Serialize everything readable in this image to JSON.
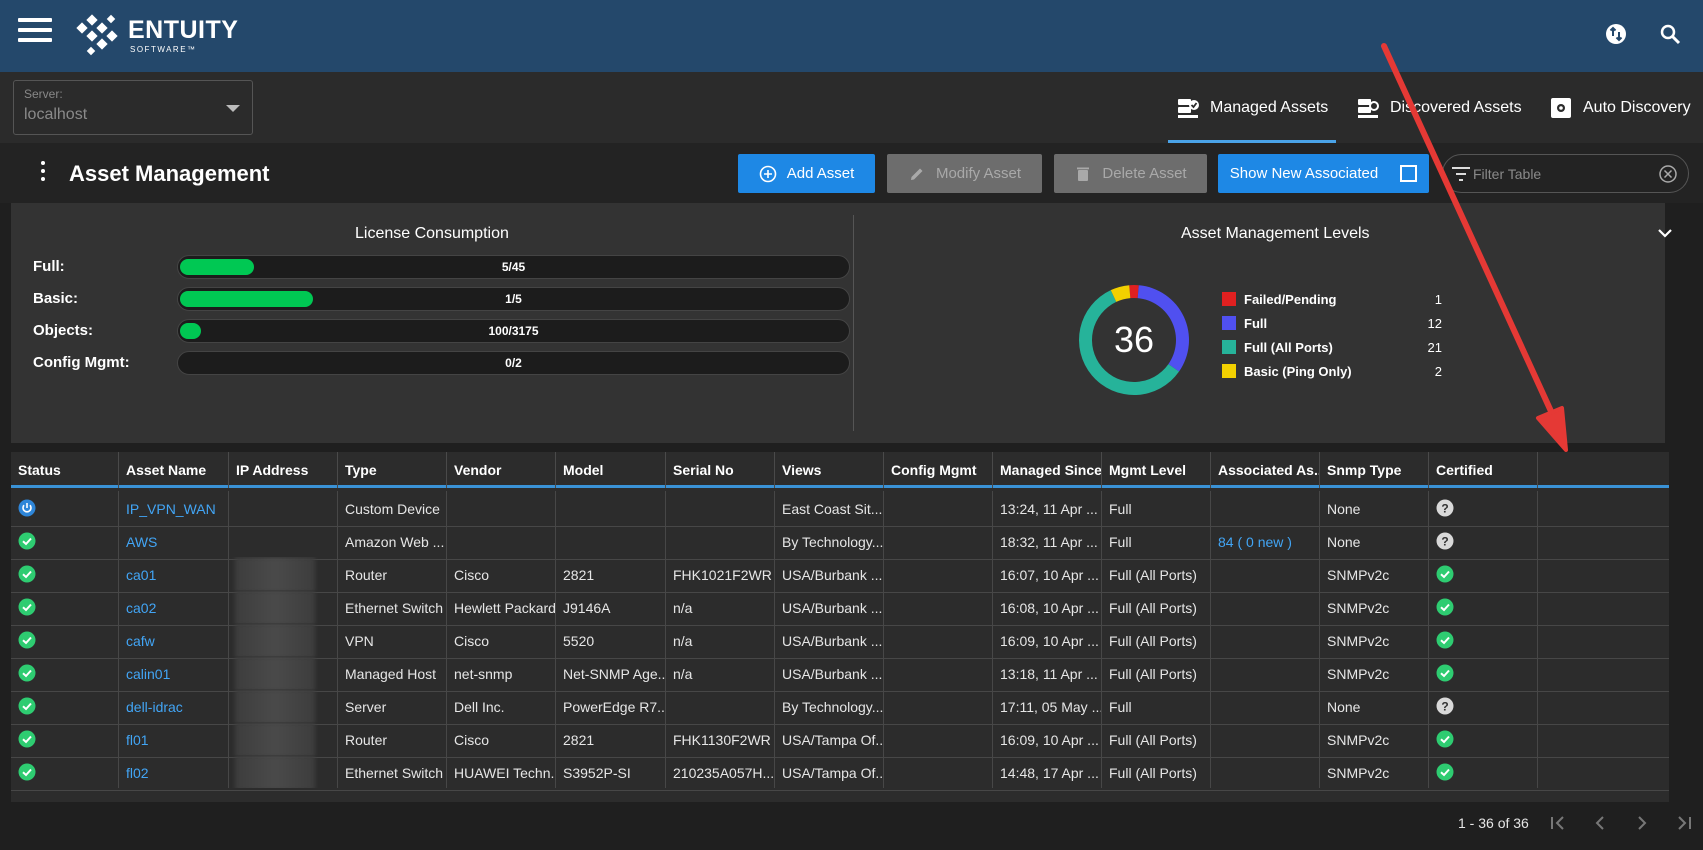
{
  "brand": {
    "name": "ENTUITY",
    "tagline": "SOFTWARE™"
  },
  "server": {
    "label": "Server:",
    "value": "localhost"
  },
  "nav_tabs": [
    {
      "label": "Managed Assets",
      "active": true
    },
    {
      "label": "Discovered Assets",
      "active": false
    },
    {
      "label": "Auto Discovery",
      "active": false
    }
  ],
  "page": {
    "title": "Asset Management"
  },
  "toolbar": {
    "add_label": "Add Asset",
    "modify_label": "Modify Asset",
    "delete_label": "Delete Asset",
    "show_new_label": "Show New Associated",
    "filter_placeholder": "Filter Table"
  },
  "license": {
    "title": "License Consumption",
    "rows": [
      {
        "label": "Full:",
        "value": "5/45",
        "fraction": 0.111
      },
      {
        "label": "Basic:",
        "value": "1/5",
        "fraction": 0.2
      },
      {
        "label": "Objects:",
        "value": "100/3175",
        "fraction": 0.031
      },
      {
        "label": "Config Mgmt:",
        "value": "0/2",
        "fraction": 0
      }
    ]
  },
  "levels": {
    "title": "Asset Management Levels",
    "total": "36",
    "items": [
      {
        "name": "Failed/Pending",
        "count": 1,
        "color": "#e02020"
      },
      {
        "name": "Full",
        "count": 12,
        "color": "#5050f0"
      },
      {
        "name": "Full (All Ports)",
        "count": 21,
        "color": "#26b39a"
      },
      {
        "name": "Basic (Ping Only)",
        "count": 2,
        "color": "#f2d000"
      }
    ]
  },
  "table": {
    "columns": [
      "Status",
      "Asset Name",
      "IP Address",
      "Type",
      "Vendor",
      "Model",
      "Serial No",
      "Views",
      "Config Mgmt",
      "Managed Since",
      "Mgmt Level",
      "Associated As...",
      "Snmp Type",
      "Certified"
    ],
    "rows": [
      {
        "status": "power",
        "name": "IP_VPN_WAN",
        "type": "Custom Device",
        "vendor": "",
        "model": "",
        "serial": "",
        "views": "East Coast Sit...",
        "config": "",
        "since": "13:24, 11 Apr ...",
        "level": "Full",
        "assoc": "",
        "snmp": "None",
        "certified": "unknown"
      },
      {
        "status": "ok",
        "name": "AWS",
        "type": "Amazon Web ...",
        "vendor": "",
        "model": "",
        "serial": "",
        "views": "By Technology...",
        "config": "",
        "since": "18:32, 11 Apr ...",
        "level": "Full",
        "assoc": "84 ( 0 new )",
        "snmp": "None",
        "certified": "unknown"
      },
      {
        "status": "ok",
        "name": "ca01",
        "type": "Router",
        "vendor": "Cisco",
        "model": "2821",
        "serial": "FHK1021F2WR",
        "views": "USA/Burbank ...",
        "config": "",
        "since": "16:07, 10 Apr ...",
        "level": "Full (All Ports)",
        "assoc": "",
        "snmp": "SNMPv2c",
        "certified": "ok"
      },
      {
        "status": "ok",
        "name": "ca02",
        "type": "Ethernet Switch",
        "vendor": "Hewlett Packard",
        "model": "J9146A",
        "serial": "n/a",
        "views": "USA/Burbank ...",
        "config": "",
        "since": "16:08, 10 Apr ...",
        "level": "Full (All Ports)",
        "assoc": "",
        "snmp": "SNMPv2c",
        "certified": "ok"
      },
      {
        "status": "ok",
        "name": "cafw",
        "type": "VPN",
        "vendor": "Cisco",
        "model": "5520",
        "serial": "n/a",
        "views": "USA/Burbank ...",
        "config": "",
        "since": "16:09, 10 Apr ...",
        "level": "Full (All Ports)",
        "assoc": "",
        "snmp": "SNMPv2c",
        "certified": "ok"
      },
      {
        "status": "ok",
        "name": "calin01",
        "type": "Managed Host",
        "vendor": "net-snmp",
        "model": "Net-SNMP Age...",
        "serial": "n/a",
        "views": "USA/Burbank ...",
        "config": "",
        "since": "13:18, 11 Apr ...",
        "level": "Full (All Ports)",
        "assoc": "",
        "snmp": "SNMPv2c",
        "certified": "ok"
      },
      {
        "status": "ok",
        "name": "dell-idrac",
        "type": "Server",
        "vendor": "Dell Inc.",
        "model": "PowerEdge R7...",
        "serial": "",
        "views": "By Technology...",
        "config": "",
        "since": "17:11, 05 May ...",
        "level": "Full",
        "assoc": "",
        "snmp": "None",
        "certified": "unknown"
      },
      {
        "status": "ok",
        "name": "fl01",
        "type": "Router",
        "vendor": "Cisco",
        "model": "2821",
        "serial": "FHK1130F2WR",
        "views": "USA/Tampa Of...",
        "config": "",
        "since": "16:09, 10 Apr ...",
        "level": "Full (All Ports)",
        "assoc": "",
        "snmp": "SNMPv2c",
        "certified": "ok"
      },
      {
        "status": "ok",
        "name": "fl02",
        "type": "Ethernet Switch",
        "vendor": "HUAWEI Techn...",
        "model": "S3952P-SI",
        "serial": "210235A057H...",
        "views": "USA/Tampa Of...",
        "config": "",
        "since": "14:48, 17 Apr ...",
        "level": "Full (All Ports)",
        "assoc": "",
        "snmp": "SNMPv2c",
        "certified": "ok"
      }
    ]
  },
  "pager": {
    "text": "1 - 36 of 36"
  },
  "colors": {
    "header": "#24486b",
    "accent": "#1e88e5",
    "ok": "#2ecc71",
    "link": "#42a5f5",
    "annotation": "#e53935"
  }
}
